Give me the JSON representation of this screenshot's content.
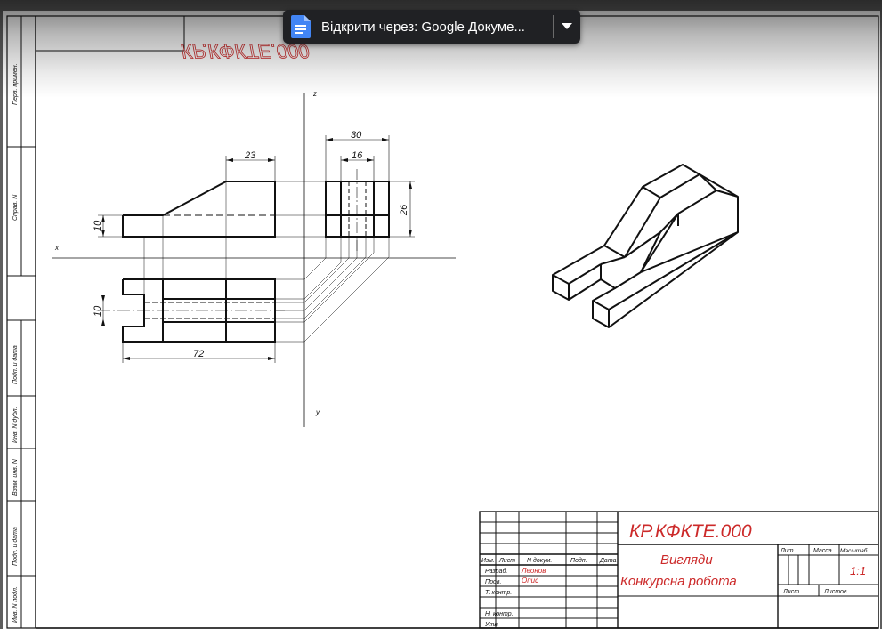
{
  "toolbar": {
    "open_with_label": "Відкрити через: Google Докуме...",
    "app_icon": "google-docs-icon",
    "menu_icon": "caret-down-icon"
  },
  "stamp_top": "КР.КФКТЕ.000",
  "side_stamp": [
    "Перв. примен.",
    "Справ. N",
    "Подп. и дата",
    "Инв. N дубл.",
    "Взам. инв. N",
    "Подп. и дата",
    "Инв. N подл."
  ],
  "axes": {
    "x": "x",
    "y": "y",
    "z": "z"
  },
  "dimensions": {
    "d23": "23",
    "d30": "30",
    "d16": "16",
    "d26": "26",
    "d10a": "10",
    "d10b": "10",
    "d72": "72"
  },
  "title_block": {
    "doc_code": "КР.КФКТЕ.000",
    "title_line1": "Вигляди",
    "title_line2": "Конкурсна робота",
    "col_headers": [
      "Изм.",
      "Лист",
      "N докум.",
      "Подп.",
      "Дата"
    ],
    "rows": [
      {
        "role": "Разраб.",
        "name": "Леонов"
      },
      {
        "role": "Пров.",
        "name": "Опис"
      },
      {
        "role": "Т. контр.",
        "name": ""
      },
      {
        "role": "Н. контр.",
        "name": ""
      },
      {
        "role": "Утв.",
        "name": ""
      }
    ],
    "lit": "Лит.",
    "mass": "Масса",
    "scale_label": "Масштаб",
    "scale_value": "1:1",
    "sheet": "Лист",
    "sheets": "Листов"
  },
  "colors": {
    "ink": "#111111",
    "red": "#cc2a2a",
    "toolbar": "#202124",
    "docs_blue": "#4285f4"
  }
}
